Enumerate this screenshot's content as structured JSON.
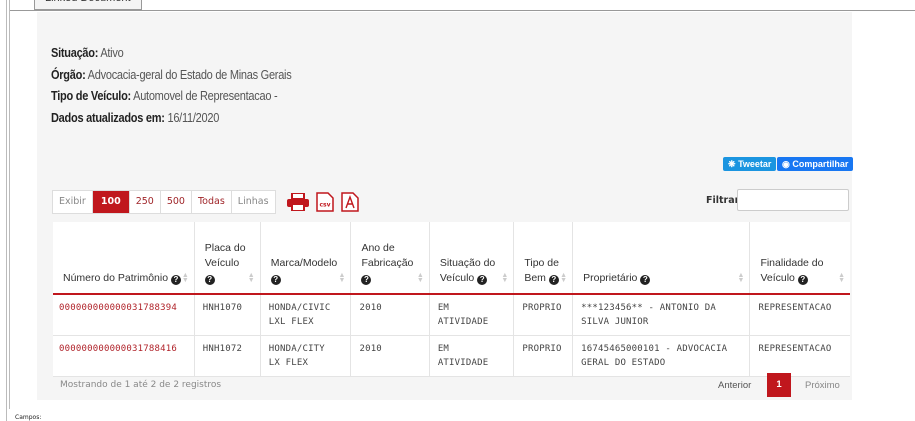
{
  "tab": {
    "label": "Linked Document"
  },
  "info": {
    "situacao_label": "Situação:",
    "situacao_value": "Ativo",
    "orgao_label": "Órgão:",
    "orgao_value": "Advocacia-geral do Estado de Minas Gerais",
    "tipo_label": "Tipo de Veículo:",
    "tipo_value": "Automovel de Representacao -",
    "dados_label": "Dados atualizados em:",
    "dados_value": "16/11/2020"
  },
  "social": {
    "tweet": "Tweetar",
    "share": "Compartilhar"
  },
  "length_menu": {
    "label_show": "Exibir",
    "options": [
      "100",
      "250",
      "500",
      "Todas"
    ],
    "selected": "100",
    "label_rows": "Linhas"
  },
  "icons": {
    "print": "printer-icon",
    "csv": "csv-icon",
    "pdf": "pdf-icon"
  },
  "filter": {
    "label": "Filtrar:",
    "value": ""
  },
  "table": {
    "headers": [
      [
        "Número do Patrimônio"
      ],
      [
        "Placa do",
        "Veículo"
      ],
      [
        "Marca/Modelo"
      ],
      [
        "Ano de",
        "Fabricação"
      ],
      [
        "Situação do",
        "Veículo"
      ],
      [
        "Tipo de",
        "Bem"
      ],
      [
        "Proprietário"
      ],
      [
        "Finalidade do",
        "Veículo"
      ]
    ],
    "rows": [
      {
        "patrimonio": "000000000000031788394",
        "placa": "HNH1070",
        "marca_1": "HONDA/CIVIC",
        "marca_2": "LXL FLEX",
        "ano": "2010",
        "situacao_1": "EM",
        "situacao_2": "ATIVIDADE",
        "tipo": "PROPRIO",
        "proprietario_1": "***123456** - ANTONIO DA",
        "proprietario_2": "SILVA JUNIOR",
        "finalidade": "REPRESENTACAO"
      },
      {
        "patrimonio": "000000000000031788416",
        "placa": "HNH1072",
        "marca_1": "HONDA/CITY",
        "marca_2": "LX FLEX",
        "ano": "2010",
        "situacao_1": "EM",
        "situacao_2": "ATIVIDADE",
        "tipo": "PROPRIO",
        "proprietario_1": "16745465000101 - ADVOCACIA",
        "proprietario_2": "GERAL DO ESTADO",
        "finalidade": "REPRESENTACAO"
      }
    ]
  },
  "footer": {
    "info": "Mostrando de 1 até 2 de 2 registros",
    "prev": "Anterior",
    "page": "1",
    "next": "Próximo"
  },
  "bottom_text": "Campos:",
  "colors": {
    "accent": "#c0171d",
    "link": "#b0232a",
    "twitter": "#1b95e0",
    "facebook": "#1877f2"
  }
}
